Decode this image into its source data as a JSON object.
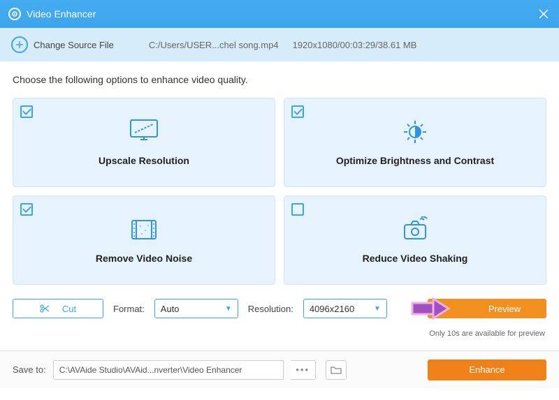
{
  "titlebar": {
    "title": "Video Enhancer"
  },
  "toolbar": {
    "change_label": "Change Source File",
    "file_path": "C:/Users/USER...chel song.mp4",
    "file_info": "1920x1080/00:03:29/38.61 MB"
  },
  "instruction": "Choose the following options to enhance video quality.",
  "options": {
    "upscale": {
      "label": "Upscale Resolution",
      "checked": true
    },
    "brightness": {
      "label": "Optimize Brightness and Contrast",
      "checked": true
    },
    "noise": {
      "label": "Remove Video Noise",
      "checked": true
    },
    "shaking": {
      "label": "Reduce Video Shaking",
      "checked": false
    }
  },
  "controls": {
    "cut_label": "Cut",
    "format_label": "Format:",
    "format_value": "Auto",
    "resolution_label": "Resolution:",
    "resolution_value": "4096x2160",
    "preview_label": "Preview",
    "note": "Only 10s are available for preview"
  },
  "footer": {
    "save_label": "Save to:",
    "save_path": "C:\\AVAide Studio\\AVAid...nverter\\Video Enhancer",
    "enhance_label": "Enhance"
  }
}
